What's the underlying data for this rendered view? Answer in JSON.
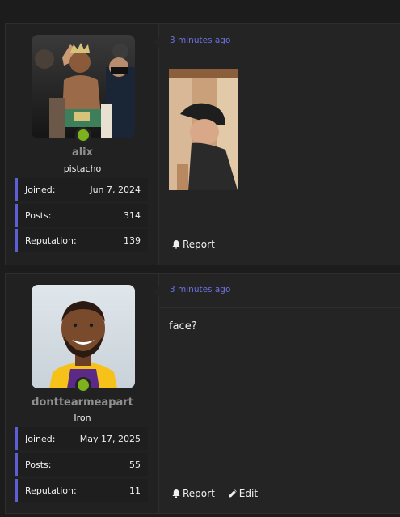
{
  "posts": [
    {
      "user": {
        "name": "alix",
        "title": "pistacho",
        "online": true,
        "avatar_icon": "boxer-photo"
      },
      "stats": [
        {
          "label": "Joined:",
          "value": "Jun 7, 2024"
        },
        {
          "label": "Posts:",
          "value": "314"
        },
        {
          "label": "Reputation:",
          "value": "139"
        }
      ],
      "timestamp": "3 minutes ago",
      "attachment_icon": "selfie-photo",
      "actions": [
        {
          "label": "Report",
          "icon": "bell-icon"
        }
      ]
    },
    {
      "user": {
        "name": "donttearmeapart",
        "title": "Iron",
        "online": true,
        "avatar_icon": "basketball-player-photo"
      },
      "stats": [
        {
          "label": "Joined:",
          "value": "May 17, 2025"
        },
        {
          "label": "Posts:",
          "value": "55"
        },
        {
          "label": "Reputation:",
          "value": "11"
        }
      ],
      "timestamp": "3 minutes ago",
      "text": "face?",
      "actions": [
        {
          "label": "Report",
          "icon": "bell-icon"
        },
        {
          "label": "Edit",
          "icon": "pencil-icon"
        }
      ]
    }
  ],
  "colors": {
    "accent": "#5c5fd6",
    "link": "#6c70e0",
    "online": "#7db21e",
    "background": "#1c1c1c",
    "panel": "#242424"
  }
}
